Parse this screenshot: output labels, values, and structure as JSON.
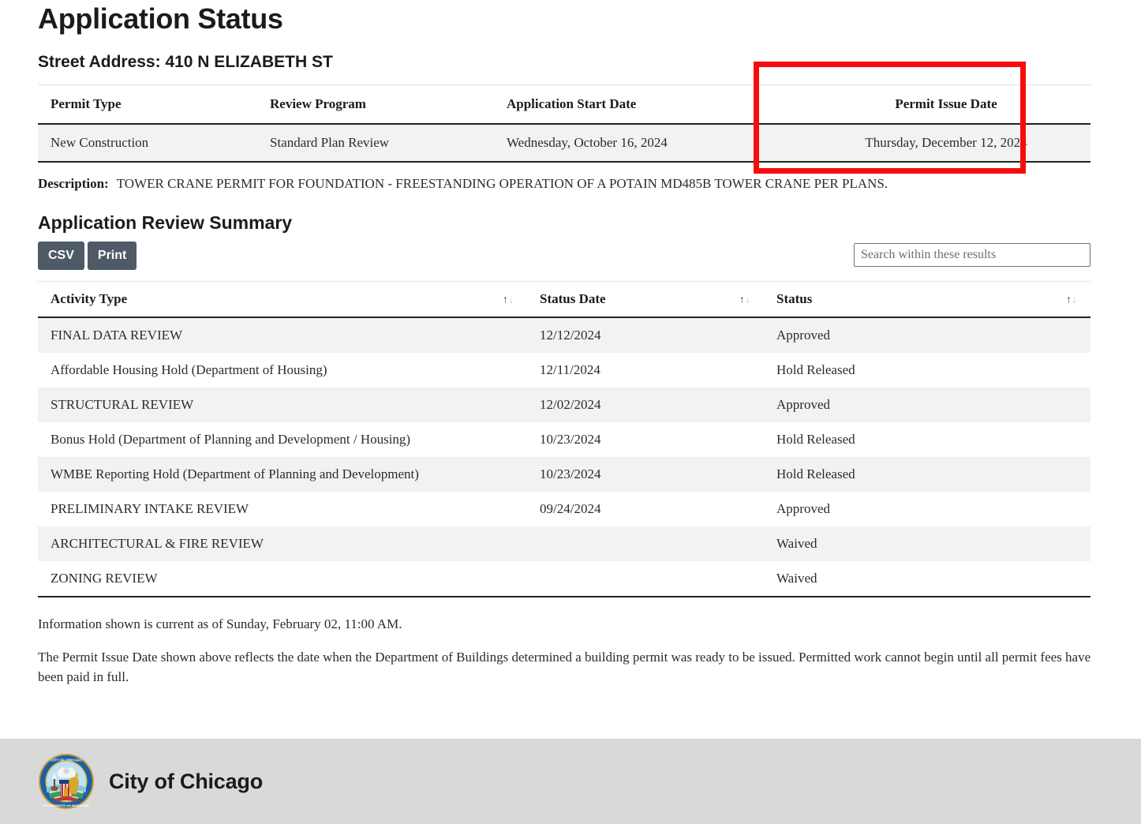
{
  "header": {
    "title": "Application Status",
    "street_address_label": "Street Address:",
    "street_address_value": "410 N ELIZABETH ST",
    "street_address_full": "Street Address: 410 N ELIZABETH ST"
  },
  "permit_table": {
    "columns": [
      "Permit Type",
      "Review Program",
      "Application Start Date",
      "Permit Issue Date"
    ],
    "row": {
      "permit_type": "New Construction",
      "review_program": "Standard Plan Review",
      "application_start_date": "Wednesday, October 16, 2024",
      "permit_issue_date": "Thursday, December 12, 2024"
    }
  },
  "description": {
    "label": "Description:",
    "text": "TOWER CRANE PERMIT FOR FOUNDATION - FREESTANDING OPERATION OF A POTAIN MD485B TOWER CRANE PER PLANS."
  },
  "review_summary": {
    "title": "Application Review Summary",
    "buttons": {
      "csv": "CSV",
      "print": "Print"
    },
    "search": {
      "placeholder": "Search within these results",
      "value": ""
    },
    "columns": [
      "Activity Type",
      "Status Date",
      "Status"
    ],
    "sort_icon_up": "↑",
    "sort_icon_down": "↓",
    "rows": [
      {
        "activity_type": "FINAL DATA REVIEW",
        "status_date": "12/12/2024",
        "status": "Approved"
      },
      {
        "activity_type": "Affordable Housing Hold (Department of Housing)",
        "status_date": "12/11/2024",
        "status": "Hold Released"
      },
      {
        "activity_type": "STRUCTURAL REVIEW",
        "status_date": "12/02/2024",
        "status": "Approved"
      },
      {
        "activity_type": "Bonus Hold (Department of Planning and Development / Housing)",
        "status_date": "10/23/2024",
        "status": "Hold Released"
      },
      {
        "activity_type": "WMBE Reporting Hold (Department of Planning and Development)",
        "status_date": "10/23/2024",
        "status": "Hold Released"
      },
      {
        "activity_type": "PRELIMINARY INTAKE REVIEW",
        "status_date": "09/24/2024",
        "status": "Approved"
      },
      {
        "activity_type": "ARCHITECTURAL & FIRE REVIEW",
        "status_date": "",
        "status": "Waived"
      },
      {
        "activity_type": "ZONING REVIEW",
        "status_date": "",
        "status": "Waived"
      }
    ]
  },
  "notes": {
    "current_as_of": "Information shown is current as of Sunday, February 02, 11:00 AM.",
    "issue_date_note": "The Permit Issue Date shown above reflects the date when the Department of Buildings determined a building permit was ready to be issued. Permitted work cannot begin until all permit fees have been paid in full."
  },
  "annotation": {
    "type": "highlight-rectangle",
    "target": "permit-issue-date-column",
    "color": "#f60c0c"
  },
  "footer": {
    "seal_alt": "city-of-chicago-seal",
    "seal_ring_top_text": "CITY OF CHICAGO",
    "seal_ring_bottom_text": "INCORPORATED 4th MARCH 1837",
    "name": "City of Chicago"
  }
}
